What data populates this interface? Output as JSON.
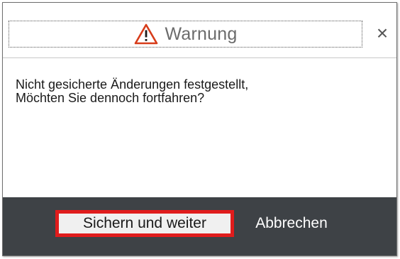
{
  "dialog": {
    "title": "Warnung",
    "title_icon": "warning-triangle-icon",
    "close_label": "×",
    "close_icon": "close-icon",
    "message_lines": [
      "Nicht gesicherte Änderungen festgestellt,",
      "Möchten Sie dennoch fortfahren?"
    ]
  },
  "footer": {
    "save_continue_label": "Sichern und weiter",
    "cancel_label": "Abbrechen"
  },
  "colors": {
    "footer_bg": "#3e4246",
    "highlight": "#e01c1c",
    "warning_icon": "#d73c1a",
    "title_text": "#6b6b6b"
  }
}
